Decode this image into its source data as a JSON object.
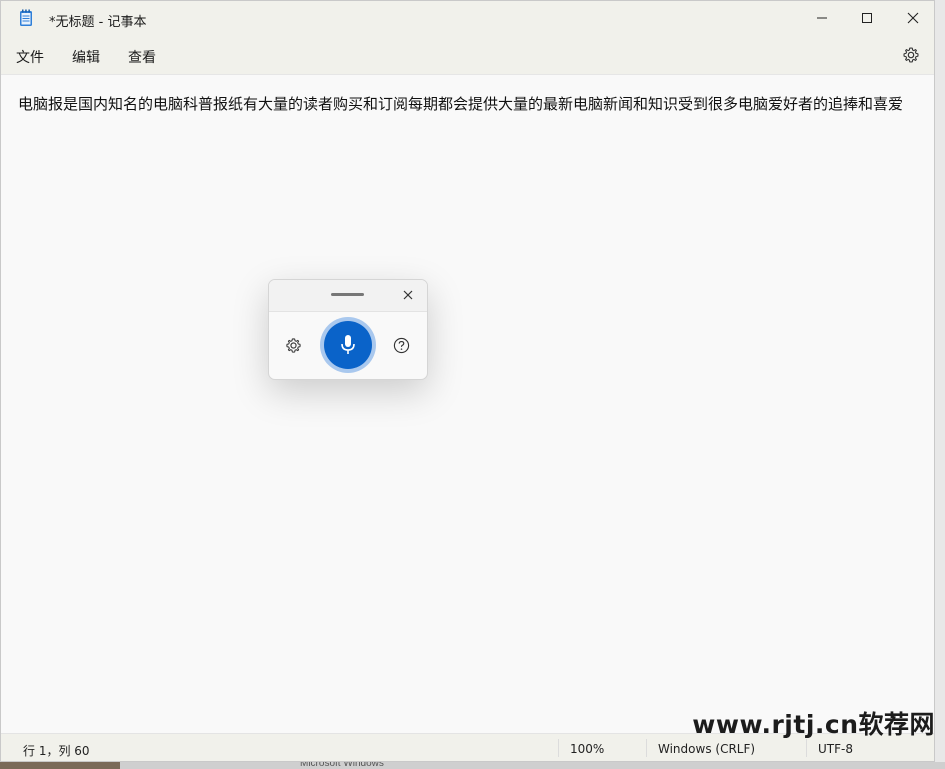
{
  "window": {
    "title": "*无标题 - 记事本",
    "app_icon": "notepad-icon",
    "caption_buttons": [
      "minimize-icon",
      "maximize-icon",
      "close-icon"
    ]
  },
  "menu": {
    "items": [
      "文件",
      "编辑",
      "查看"
    ],
    "settings_icon": "gear-icon"
  },
  "editor": {
    "content": "电脑报是国内知名的电脑科普报纸有大量的读者购买和订阅每期都会提供大量的最新电脑新闻和知识受到很多电脑爱好者的追捧和喜爱"
  },
  "voice_typing": {
    "drag_handle_icon": "drag-handle-icon",
    "close_icon": "close-icon",
    "settings_icon": "gear-icon",
    "mic_icon": "microphone-icon",
    "help_icon": "help-icon",
    "accent": "#0a63c9"
  },
  "status": {
    "position": "行 1，列 60",
    "zoom": "100%",
    "line_ending": "Windows (CRLF)",
    "encoding": "UTF-8"
  },
  "background": {
    "taskbar_text": "Microsoft Windows"
  },
  "watermark": "www.rjtj.cn软荐网"
}
